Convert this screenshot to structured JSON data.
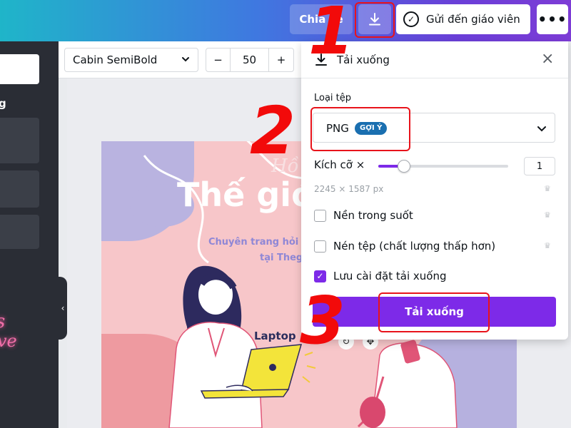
{
  "topbar": {
    "share_label": "Chia sẻ",
    "send_label": "Gửi đến giáo viên",
    "more_label": "•••"
  },
  "toolbar": {
    "font_name": "Cabin SemiBold",
    "font_size": "50",
    "minus_label": "−",
    "plus_label": "+"
  },
  "left_panel": {
    "heading": "g",
    "neon_line1": "s",
    "neon_line2": "ve",
    "collapse_label": "‹"
  },
  "design": {
    "cursive_text": "Hồ",
    "title": "Thế giớ",
    "subtitle_line1": "Chuyên trang hỏi đáp",
    "subtitle_line2": "tại Thegio",
    "laptop_label": "Laptop"
  },
  "download_panel": {
    "title": "Tải xuống",
    "close_label": "×",
    "file_type_label": "Loại tệp",
    "file_type_value": "PNG",
    "file_type_badge": "GỢI Ý",
    "size_label": "Kích cỡ ×",
    "size_value": "1",
    "size_slider_fraction": 0.2,
    "dimensions": "2245 × 1587 px",
    "options": [
      {
        "label": "Nền trong suốt",
        "checked": false,
        "pro": true
      },
      {
        "label": "Nén tệp (chất lượng thấp hơn)",
        "checked": false,
        "pro": true
      },
      {
        "label": "Lưu cài đặt tải xuống",
        "checked": true,
        "pro": false
      }
    ],
    "download_button": "Tải xuống"
  },
  "annotations": {
    "step1": "1",
    "step2": "2",
    "step3": "3",
    "color": "#f20a0a"
  },
  "colors": {
    "accent_purple": "#7d2ae8",
    "badge_blue": "#1a6fb0",
    "design_pink": "#f7c6c9",
    "design_lavender": "#b9b3e0"
  },
  "icons": [
    "download-icon",
    "check-circle-icon",
    "more-icon",
    "chevron-down-icon",
    "close-icon",
    "crown-icon",
    "rotate-icon",
    "move-icon"
  ]
}
